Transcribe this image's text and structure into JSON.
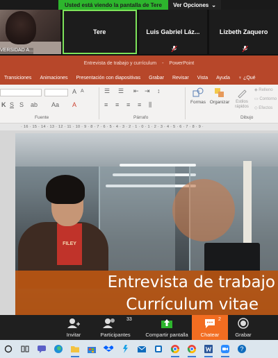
{
  "banner": {
    "text": "Usted está viendo la pantalla de Tere",
    "options": "Ver Opciones"
  },
  "participants": {
    "cam_label": "VERSIDAD A...",
    "active_name": "Tere",
    "name2": "Luis Gabriel Láz...",
    "name3": "Lizbeth Zaquero"
  },
  "powerpoint": {
    "doc_title": "Entrevista de trabajo y currículum",
    "app_name": "PowerPoint",
    "tabs": [
      "Transiciones",
      "Animaciones",
      "Presentación con diapositivas",
      "Grabar",
      "Revisar",
      "Vista",
      "Ayuda"
    ],
    "tell_me": "¿Qué",
    "ribbon": {
      "font_group": "Fuente",
      "paragraph_group": "Párrafo",
      "drawing_group": "Dibujo",
      "shapes": "Formas",
      "arrange": "Organizar",
      "styles": "Estilos rápidos",
      "fill": "Relleno",
      "outline": "Contorno",
      "effects": "Efectos"
    },
    "ruler": "· 16 · 15 · 14 · 13 · 12 · 11 · 10 · 9 · 8 · 7 · 6 · 5 · 4 · 3 · 2 · 1 · 0 · 1 · 2 · 3 · 4 · 5 · 6 · 7 · 8 · 9 ·",
    "slide_title": "Entrevista de trabajo",
    "slide_subtitle": "Currículum vitae",
    "shirt_text": "FILEY"
  },
  "toolbar": {
    "invite": "Invitar",
    "participants": "Participantes",
    "participants_count": "33",
    "share": "Compartir pantalla",
    "chat": "Chatear",
    "chat_count": "2",
    "record": "Grabar"
  },
  "colors": {
    "ppt_red": "#b7472a",
    "zoom_green": "#2db52d",
    "chat_orange": "#f26d21",
    "active_border": "#7de35a"
  },
  "taskbar_icons": [
    "cortana-circle-icon",
    "task-view-icon",
    "chat-icon",
    "edge-icon",
    "file-explorer-icon",
    "store-icon",
    "dropbox-icon",
    "sandbox-icon",
    "mail-icon",
    "phone-icon",
    "chrome-icon",
    "chrome-icon",
    "word-icon",
    "zoom-icon",
    "help-icon"
  ]
}
